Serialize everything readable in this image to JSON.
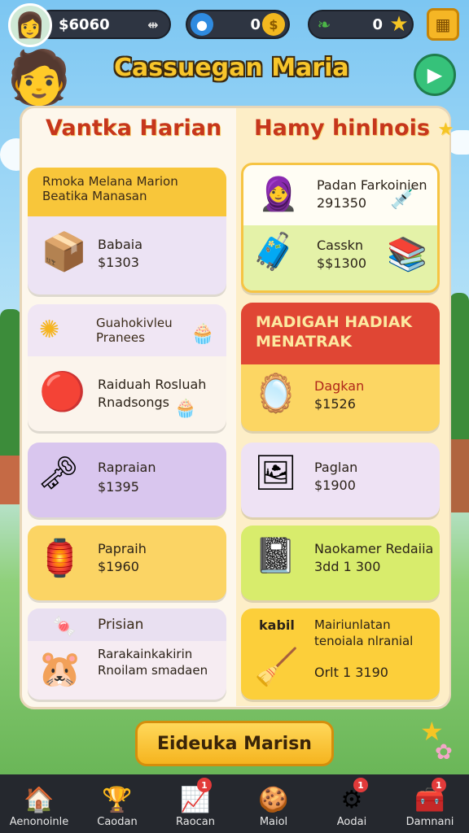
{
  "hud": {
    "coins": "$6060",
    "gems": "0",
    "leaves": "0"
  },
  "title": "Cassuegan Maria",
  "columns": {
    "left": "Vantka Harian",
    "right": "Hamy hinlnois"
  },
  "left_cards": [
    {
      "band": "Rmoka Melana Marion Beatika Manasan",
      "name": "Babaia",
      "price": "$1303",
      "icon": "box-icon"
    },
    {
      "band": "Guahokivleu Pranees",
      "name": "Raiduah Rosluah Rnadsongs",
      "price": "",
      "icon": "ball-icon"
    },
    {
      "band": "",
      "name": "Rapraian",
      "price": "$1395",
      "icon": "key-icon"
    },
    {
      "band": "",
      "name": "Papraih",
      "price": "$1960",
      "icon": "lantern-icon"
    },
    {
      "band": "Prisian",
      "name": "Rarakainkakirin Rnoilam smadaen",
      "price": "",
      "icon": "hamster-icon"
    }
  ],
  "right_cards": [
    {
      "band": "",
      "name": "Padan Farkoinien",
      "price": "291350",
      "icon": "character-icon"
    },
    {
      "band": "",
      "name": "Casskn",
      "price": "$$1300",
      "icon": "tablet-icon"
    },
    {
      "band": "MADIGAH HADIAK MENATRAK",
      "name": "Dagkan",
      "price": "$1526",
      "icon": "mirror-icon"
    },
    {
      "band": "",
      "name": "Paglan",
      "price": "$1900",
      "icon": "frame-icon"
    },
    {
      "band": "",
      "name": "Naokamer Redaiia",
      "price": "3dd 1 300",
      "icon": "notebook-icon"
    },
    {
      "band": "kabil",
      "name": "Mairiunlatan tenoiala nlranial",
      "price": "Orlt 1 3190",
      "icon": "broom-icon"
    }
  ],
  "cta": "Eideuka Marisn",
  "nav": [
    {
      "label": "Aenonoinle",
      "icon": "home-icon",
      "badge": ""
    },
    {
      "label": "Caodan",
      "icon": "trophy-icon",
      "badge": ""
    },
    {
      "label": "Raocan",
      "icon": "chart-icon",
      "badge": "1"
    },
    {
      "label": "Maiol",
      "icon": "cookie-icon",
      "badge": ""
    },
    {
      "label": "Aodai",
      "icon": "gear-icon",
      "badge": "1"
    },
    {
      "label": "Damnani",
      "icon": "chest-icon",
      "badge": "1"
    }
  ]
}
